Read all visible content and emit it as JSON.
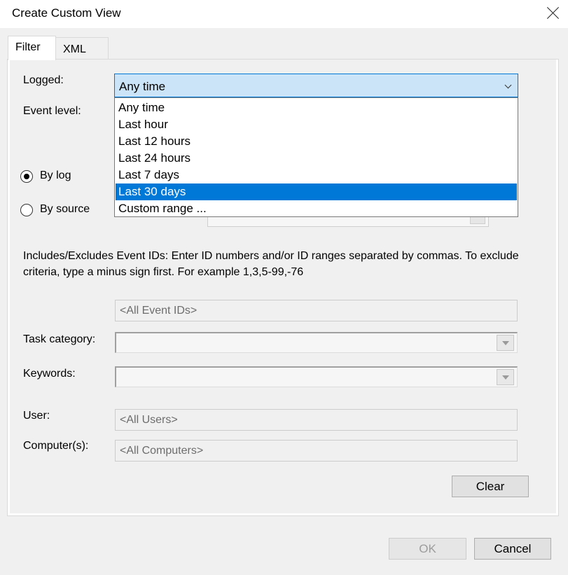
{
  "window": {
    "title": "Create Custom View"
  },
  "tabs": [
    {
      "label": "Filter"
    },
    {
      "label": "XML"
    }
  ],
  "filter": {
    "logged_label": "Logged:",
    "logged_value": "Any time",
    "logged_options": [
      "Any time",
      "Last hour",
      "Last 12 hours",
      "Last 24 hours",
      "Last 7 days",
      "Last 30 days",
      "Custom range ..."
    ],
    "logged_highlighted": "Last 30 days",
    "event_level_label": "Event level:",
    "by_log_label": "By log",
    "by_source_label": "By source",
    "by_log_selected": true,
    "event_ids_description": "Includes/Excludes Event IDs: Enter ID numbers and/or ID ranges separated by commas. To exclude criteria, type a minus sign first. For example 1,3,5-99,-76",
    "event_ids_placeholder": "<All Event IDs>",
    "task_category_label": "Task category:",
    "keywords_label": "Keywords:",
    "user_label": "User:",
    "user_placeholder": "<All Users>",
    "computers_label": "Computer(s):",
    "computers_placeholder": "<All Computers>",
    "clear_label": "Clear"
  },
  "footer": {
    "ok_label": "OK",
    "cancel_label": "Cancel"
  },
  "colors": {
    "accent": "#0078d7",
    "select_bg": "#cce4f7"
  }
}
